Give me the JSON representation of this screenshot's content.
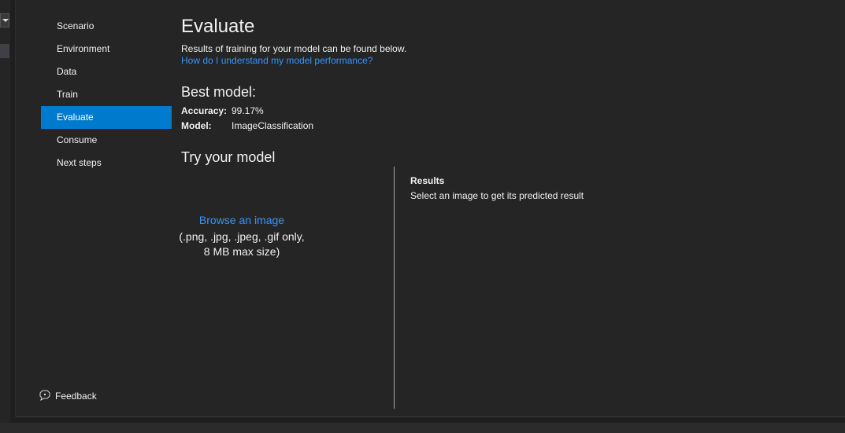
{
  "nav": {
    "items": [
      {
        "label": "Scenario"
      },
      {
        "label": "Environment"
      },
      {
        "label": "Data"
      },
      {
        "label": "Train"
      },
      {
        "label": "Evaluate",
        "active": true
      },
      {
        "label": "Consume"
      },
      {
        "label": "Next steps"
      }
    ],
    "feedback_label": "Feedback"
  },
  "main": {
    "title": "Evaluate",
    "subtitle": "Results of training for your model can be found below.",
    "help_link": "How do I understand my model performance?",
    "best_model": {
      "heading": "Best model:",
      "accuracy_label": "Accuracy:",
      "accuracy_value": "99.17%",
      "model_label": "Model:",
      "model_value": "ImageClassification"
    },
    "try": {
      "heading": "Try your model",
      "browse_label": "Browse an image",
      "formats_line1": "(.png, .jpg, .jpeg, .gif only,",
      "formats_line2": "8 MB max size)"
    },
    "results": {
      "heading": "Results",
      "placeholder": "Select an image to get its predicted result"
    }
  },
  "colors": {
    "accent": "#007acc",
    "link": "#3794ff",
    "background": "#252526"
  }
}
